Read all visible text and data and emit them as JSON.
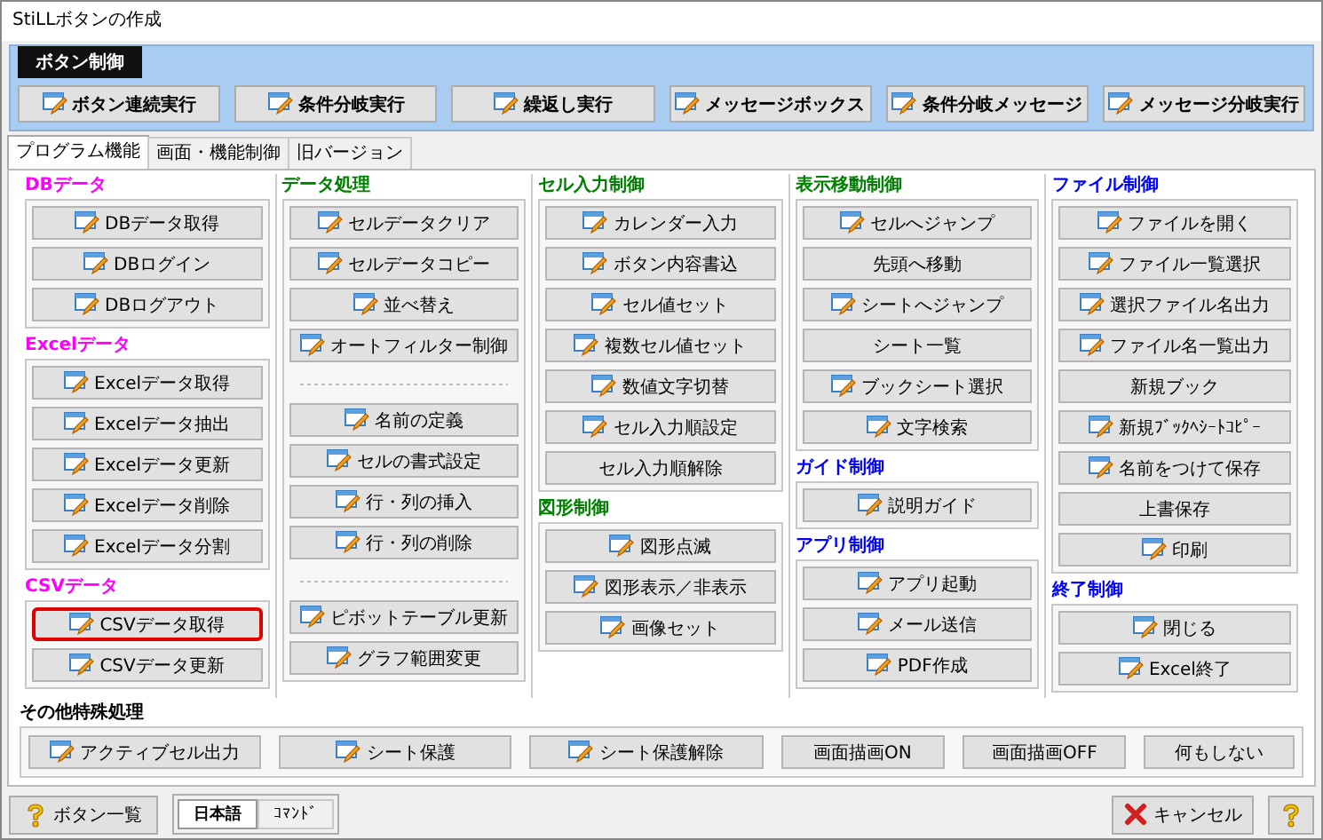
{
  "window": {
    "title": "StiLLボタンの作成"
  },
  "button_control": {
    "tab": "ボタン制御",
    "buttons": [
      {
        "label": "ボタン連続実行"
      },
      {
        "label": "条件分岐実行"
      },
      {
        "label": "繰返し実行"
      },
      {
        "label": "メッセージボックス"
      },
      {
        "label": "条件分岐メッセージ"
      },
      {
        "label": "メッセージ分岐実行"
      }
    ]
  },
  "tabs": [
    {
      "label": "プログラム機能",
      "selected": true
    },
    {
      "label": "画面・機能制御",
      "selected": false
    },
    {
      "label": "旧バージョン",
      "selected": false
    }
  ],
  "columns": [
    {
      "groups": [
        {
          "title": "DBデータ",
          "color": "#ff00ff",
          "items": [
            {
              "kind": "button",
              "label": "DBデータ取得",
              "icon": true,
              "highlighted": false
            },
            {
              "kind": "button",
              "label": "DBログイン",
              "icon": true,
              "highlighted": false
            },
            {
              "kind": "button",
              "label": "DBログアウト",
              "icon": true,
              "highlighted": false
            }
          ]
        },
        {
          "title": "Excelデータ",
          "color": "#ff00ff",
          "items": [
            {
              "kind": "button",
              "label": "Excelデータ取得",
              "icon": true,
              "highlighted": false
            },
            {
              "kind": "button",
              "label": "Excelデータ抽出",
              "icon": true,
              "highlighted": false
            },
            {
              "kind": "button",
              "label": "Excelデータ更新",
              "icon": true,
              "highlighted": false
            },
            {
              "kind": "button",
              "label": "Excelデータ削除",
              "icon": true,
              "highlighted": false
            },
            {
              "kind": "button",
              "label": "Excelデータ分割",
              "icon": true,
              "highlighted": false
            }
          ]
        },
        {
          "title": "CSVデータ",
          "color": "#ff00ff",
          "items": [
            {
              "kind": "button",
              "label": "CSVデータ取得",
              "icon": true,
              "highlighted": true
            },
            {
              "kind": "button",
              "label": "CSVデータ更新",
              "icon": true,
              "highlighted": false
            }
          ]
        }
      ]
    },
    {
      "groups": [
        {
          "title": "データ処理",
          "color": "#008000",
          "items": [
            {
              "kind": "button",
              "label": "セルデータクリア",
              "icon": true,
              "highlighted": false
            },
            {
              "kind": "button",
              "label": "セルデータコピー",
              "icon": true,
              "highlighted": false
            },
            {
              "kind": "button",
              "label": "並べ替え",
              "icon": true,
              "highlighted": false
            },
            {
              "kind": "button",
              "label": "オートフィルター制御",
              "icon": true,
              "highlighted": false
            },
            {
              "kind": "separator"
            },
            {
              "kind": "button",
              "label": "名前の定義",
              "icon": true,
              "highlighted": false
            },
            {
              "kind": "button",
              "label": "セルの書式設定",
              "icon": true,
              "highlighted": false
            },
            {
              "kind": "button",
              "label": "行・列の挿入",
              "icon": true,
              "highlighted": false
            },
            {
              "kind": "button",
              "label": "行・列の削除",
              "icon": true,
              "highlighted": false
            },
            {
              "kind": "separator"
            },
            {
              "kind": "button",
              "label": "ピボットテーブル更新",
              "icon": true,
              "highlighted": false
            },
            {
              "kind": "button",
              "label": "グラフ範囲変更",
              "icon": true,
              "highlighted": false
            }
          ]
        }
      ]
    },
    {
      "groups": [
        {
          "title": "セル入力制御",
          "color": "#008000",
          "items": [
            {
              "kind": "button",
              "label": "カレンダー入力",
              "icon": true,
              "highlighted": false
            },
            {
              "kind": "button",
              "label": "ボタン内容書込",
              "icon": true,
              "highlighted": false
            },
            {
              "kind": "button",
              "label": "セル値セット",
              "icon": true,
              "highlighted": false
            },
            {
              "kind": "button",
              "label": "複数セル値セット",
              "icon": true,
              "highlighted": false
            },
            {
              "kind": "button",
              "label": "数値文字切替",
              "icon": true,
              "highlighted": false
            },
            {
              "kind": "button",
              "label": "セル入力順設定",
              "icon": true,
              "highlighted": false
            },
            {
              "kind": "button",
              "label": "セル入力順解除",
              "icon": false,
              "highlighted": false
            }
          ]
        },
        {
          "title": "図形制御",
          "color": "#008000",
          "items": [
            {
              "kind": "button",
              "label": "図形点滅",
              "icon": true,
              "highlighted": false
            },
            {
              "kind": "button",
              "label": "図形表示／非表示",
              "icon": true,
              "highlighted": false
            },
            {
              "kind": "button",
              "label": "画像セット",
              "icon": true,
              "highlighted": false
            }
          ]
        }
      ]
    },
    {
      "groups": [
        {
          "title": "表示移動制御",
          "color": "#008000",
          "items": [
            {
              "kind": "button",
              "label": "セルへジャンプ",
              "icon": true,
              "highlighted": false
            },
            {
              "kind": "button",
              "label": "先頭へ移動",
              "icon": false,
              "highlighted": false
            },
            {
              "kind": "button",
              "label": "シートへジャンプ",
              "icon": true,
              "highlighted": false
            },
            {
              "kind": "button",
              "label": "シート一覧",
              "icon": false,
              "highlighted": false
            },
            {
              "kind": "button",
              "label": "ブックシート選択",
              "icon": true,
              "highlighted": false
            },
            {
              "kind": "button",
              "label": "文字検索",
              "icon": true,
              "highlighted": false
            }
          ]
        },
        {
          "title": "ガイド制御",
          "color": "#0000ff",
          "items": [
            {
              "kind": "button",
              "label": "説明ガイド",
              "icon": true,
              "highlighted": false
            }
          ]
        },
        {
          "title": "アプリ制御",
          "color": "#0000ff",
          "items": [
            {
              "kind": "button",
              "label": "アプリ起動",
              "icon": true,
              "highlighted": false
            },
            {
              "kind": "button",
              "label": "メール送信",
              "icon": true,
              "highlighted": false
            },
            {
              "kind": "button",
              "label": "PDF作成",
              "icon": true,
              "highlighted": false
            }
          ]
        }
      ]
    },
    {
      "groups": [
        {
          "title": "ファイル制御",
          "color": "#0000ff",
          "items": [
            {
              "kind": "button",
              "label": "ファイルを開く",
              "icon": true,
              "highlighted": false
            },
            {
              "kind": "button",
              "label": "ファイル一覧選択",
              "icon": true,
              "highlighted": false
            },
            {
              "kind": "button",
              "label": "選択ファイル名出力",
              "icon": true,
              "highlighted": false
            },
            {
              "kind": "button",
              "label": "ファイル名一覧出力",
              "icon": true,
              "highlighted": false
            },
            {
              "kind": "button",
              "label": "新規ブック",
              "icon": false,
              "highlighted": false
            },
            {
              "kind": "button",
              "label": "新規ﾌﾞｯｸﾍｼｰﾄｺﾋﾟｰ",
              "icon": true,
              "highlighted": false
            },
            {
              "kind": "button",
              "label": "名前をつけて保存",
              "icon": true,
              "highlighted": false
            },
            {
              "kind": "button",
              "label": "上書保存",
              "icon": false,
              "highlighted": false
            },
            {
              "kind": "button",
              "label": "印刷",
              "icon": true,
              "highlighted": false
            }
          ]
        },
        {
          "title": "終了制御",
          "color": "#0000ff",
          "items": [
            {
              "kind": "button",
              "label": "閉じる",
              "icon": true,
              "highlighted": false
            },
            {
              "kind": "button",
              "label": "Excel終了",
              "icon": true,
              "highlighted": false
            }
          ]
        }
      ]
    }
  ],
  "special": {
    "title": "その他特殊処理",
    "items": [
      {
        "label": "アクティブセル出力",
        "icon": true
      },
      {
        "label": "シート保護",
        "icon": true
      },
      {
        "label": "シート保護解除",
        "icon": true
      },
      {
        "label": "画面描画ON",
        "icon": false
      },
      {
        "label": "画面描画OFF",
        "icon": false
      },
      {
        "label": "何もしない",
        "icon": false
      }
    ]
  },
  "footer": {
    "list_button": "ボタン一覧",
    "modes": [
      {
        "label": "日本語",
        "selected": true
      },
      {
        "label": "ｺﾏﾝﾄﾞ",
        "selected": false
      }
    ],
    "cancel_button": "キャンセル"
  }
}
